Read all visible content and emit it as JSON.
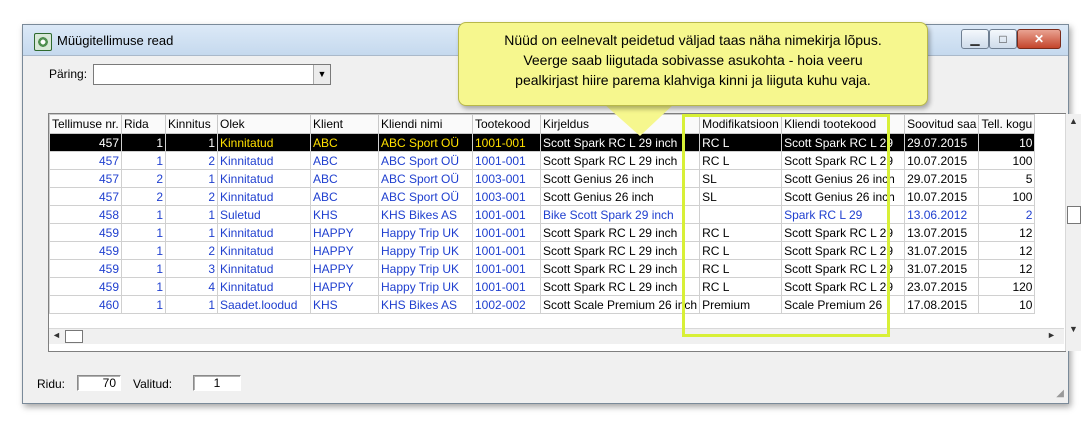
{
  "window": {
    "title": "Müügitellimuse read",
    "min_glyph": "▁",
    "max_glyph": "□",
    "close_glyph": "✕"
  },
  "query": {
    "label": "Päring:",
    "value": "",
    "arrow": "▼"
  },
  "table": {
    "columns": [
      "Tellimuse nr.",
      "Rida",
      "Kinnitus",
      "Olek",
      "Klient",
      "Kliendi nimi",
      "Tootekood",
      "Kirjeldus",
      "Modifikatsioon",
      "Kliendi tootekood",
      "Soovitud saa",
      "Tell. kogu"
    ],
    "rows": [
      [
        "457",
        "1",
        "1",
        "Kinnitatud",
        "ABC",
        "ABC Sport OÜ",
        "1001-001",
        "Scott Spark RC L 29 inch",
        "RC L",
        "Scott Spark RC L 29",
        "29.07.2015",
        "10"
      ],
      [
        "457",
        "1",
        "2",
        "Kinnitatud",
        "ABC",
        "ABC Sport OÜ",
        "1001-001",
        "Scott Spark RC L 29 inch",
        "RC L",
        "Scott Spark RC L 29",
        "10.07.2015",
        "100"
      ],
      [
        "457",
        "2",
        "1",
        "Kinnitatud",
        "ABC",
        "ABC Sport OÜ",
        "1003-001",
        "Scott Genius 26 inch",
        "SL",
        "Scott Genius 26 inch",
        "29.07.2015",
        "5"
      ],
      [
        "457",
        "2",
        "2",
        "Kinnitatud",
        "ABC",
        "ABC Sport OÜ",
        "1003-001",
        "Scott Genius 26 inch",
        "SL",
        "Scott Genius 26 inch",
        "10.07.2015",
        "100"
      ],
      [
        "458",
        "1",
        "1",
        "Suletud",
        "KHS",
        "KHS Bikes AS",
        "1001-001",
        "Bike Scott Spark 29 inch",
        "",
        "Spark RC L 29",
        "13.06.2012",
        "2"
      ],
      [
        "459",
        "1",
        "1",
        "Kinnitatud",
        "HAPPY",
        "Happy Trip UK",
        "1001-001",
        "Scott Spark RC L 29 inch",
        "RC L",
        "Scott Spark RC L 29",
        "13.07.2015",
        "12"
      ],
      [
        "459",
        "1",
        "2",
        "Kinnitatud",
        "HAPPY",
        "Happy Trip UK",
        "1001-001",
        "Scott Spark RC L 29 inch",
        "RC L",
        "Scott Spark RC L 29",
        "31.07.2015",
        "12"
      ],
      [
        "459",
        "1",
        "3",
        "Kinnitatud",
        "HAPPY",
        "Happy Trip UK",
        "1001-001",
        "Scott Spark RC L 29 inch",
        "RC L",
        "Scott Spark RC L 29",
        "31.07.2015",
        "12"
      ],
      [
        "459",
        "1",
        "4",
        "Kinnitatud",
        "HAPPY",
        "Happy Trip UK",
        "1001-001",
        "Scott Spark RC L 29 inch",
        "RC L",
        "Scott Spark RC L 29",
        "23.07.2015",
        "120"
      ],
      [
        "460",
        "1",
        "1",
        "Saadet.loodud",
        "KHS",
        "KHS Bikes AS",
        "1002-002",
        "Scott Scale Premium 26 inch",
        "Premium",
        "Scale Premium 26",
        "17.08.2015",
        "10"
      ]
    ]
  },
  "scroll": {
    "up": "▲",
    "down": "▼",
    "left": "◄",
    "right": "►"
  },
  "status": {
    "rows_label": "Ridu:",
    "rows_value": "70",
    "selected_label": "Valitud:",
    "selected_value": "1"
  },
  "callout": {
    "lines": [
      "Nüüd on eelnevalt peidetud väljad taas näha nimekirja lõpus.",
      "Veerge saab liigutada sobivasse asukohta -  hoia veeru",
      "pealkirjast hiire parema klahviga kinni ja liiguta kuhu vaja."
    ]
  },
  "colors": {
    "highlight": "#d8f037",
    "link_text": "#1f3fcf",
    "callout_bg": "#f6f78e"
  }
}
